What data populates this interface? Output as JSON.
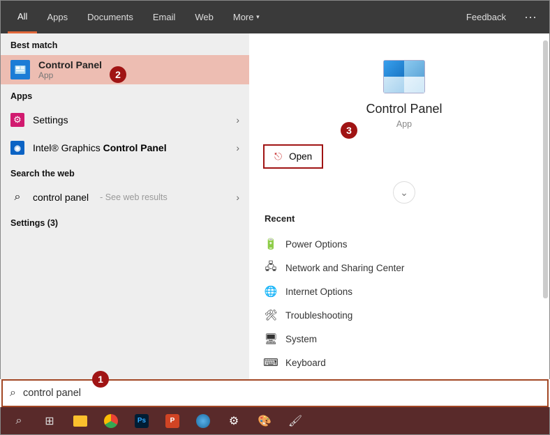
{
  "nav": {
    "tabs": [
      "All",
      "Apps",
      "Documents",
      "Email",
      "Web",
      "More"
    ],
    "active_index": 0,
    "feedback": "Feedback",
    "more_dots": "···"
  },
  "left": {
    "best_match_header": "Best match",
    "best_match": {
      "title": "Control Panel",
      "subtitle": "App"
    },
    "apps_header": "Apps",
    "apps": [
      {
        "label": "Settings",
        "icon": "gear-icon"
      },
      {
        "label_prefix": "Intel® Graphics ",
        "label_bold": "Control Panel",
        "icon": "intel-icon"
      }
    ],
    "web_header": "Search the web",
    "web": {
      "query": "control panel",
      "suffix": " - See web results"
    },
    "settings_header": "Settings (3)"
  },
  "right": {
    "title": "Control Panel",
    "subtitle": "App",
    "open": "Open",
    "recent_header": "Recent",
    "recent": [
      {
        "label": "Power Options",
        "icon": "power-icon"
      },
      {
        "label": "Network and Sharing Center",
        "icon": "network-icon"
      },
      {
        "label": "Internet Options",
        "icon": "globe-icon"
      },
      {
        "label": "Troubleshooting",
        "icon": "troubleshoot-icon"
      },
      {
        "label": "System",
        "icon": "system-icon"
      },
      {
        "label": "Keyboard",
        "icon": "keyboard-icon"
      }
    ]
  },
  "search": {
    "value": "control panel"
  },
  "annotations": {
    "one": "1",
    "two": "2",
    "three": "3"
  },
  "taskbar_icons": [
    "search",
    "taskview",
    "explorer",
    "chrome",
    "photoshop",
    "powerpoint",
    "iobit",
    "settings",
    "paint3d",
    "mspaint"
  ]
}
